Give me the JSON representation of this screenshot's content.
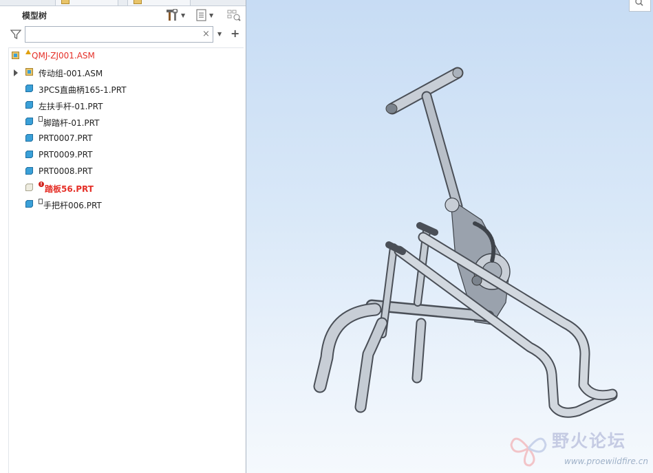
{
  "panel": {
    "title": "模型树",
    "search": {
      "value": "",
      "placeholder": ""
    },
    "clear_glyph": "×",
    "add_glyph": "+"
  },
  "icons": {
    "tools": "hammer-wrench-icon",
    "tree_settings": "tree-list-icon",
    "display_filter": "filter-display-icon",
    "filter": "funnel-icon",
    "view": "zoom-view-icon"
  },
  "tree": {
    "root": {
      "label": "QMJ-ZJ001.ASM",
      "status": "warning"
    },
    "items": [
      {
        "label": "传动组-001.ASM",
        "type": "asm",
        "expandable": true,
        "marker": ""
      },
      {
        "label": "3PCS直曲柄165-1.PRT",
        "type": "prt",
        "expandable": false,
        "marker": ""
      },
      {
        "label": "左扶手杆-01.PRT",
        "type": "prt",
        "expandable": false,
        "marker": ""
      },
      {
        "label": "脚踏杆-01.PRT",
        "type": "prt",
        "expandable": false,
        "marker": "box"
      },
      {
        "label": "PRT0007.PRT",
        "type": "prt",
        "expandable": false,
        "marker": ""
      },
      {
        "label": "PRT0009.PRT",
        "type": "prt",
        "expandable": false,
        "marker": ""
      },
      {
        "label": "PRT0008.PRT",
        "type": "prt",
        "expandable": false,
        "marker": ""
      },
      {
        "label": "踏板56.PRT",
        "type": "prt-failed",
        "expandable": false,
        "marker": "error"
      },
      {
        "label": "手把杆006.PRT",
        "type": "prt",
        "expandable": false,
        "marker": "box"
      }
    ]
  },
  "watermark": {
    "name": "野火论坛",
    "url": "www.proewildfire.cn"
  },
  "colors": {
    "error": "#e53028",
    "part_blue": "#3aa0d8",
    "asm_yellow": "#e8c46a",
    "viewport_top": "#c7dcf4"
  }
}
